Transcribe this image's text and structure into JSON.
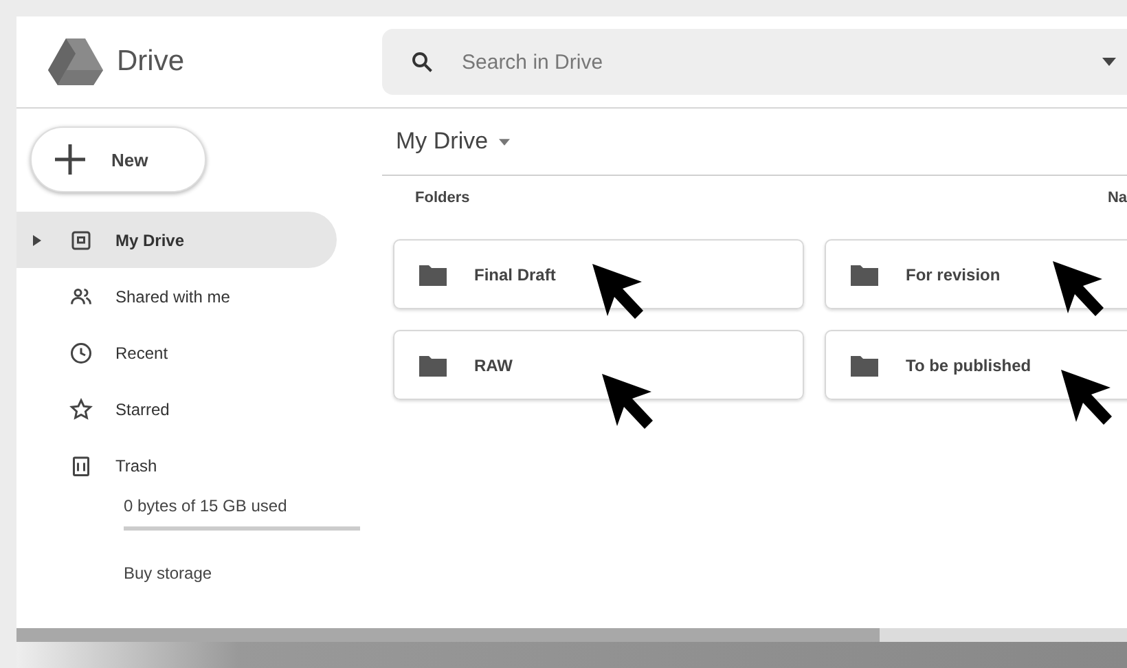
{
  "header": {
    "app_name": "Drive",
    "search": {
      "placeholder": "Search in Drive"
    }
  },
  "sidebar": {
    "new_button": "New",
    "items": [
      {
        "label": "My Drive",
        "kind": "drive",
        "selected": true,
        "expanded": false
      },
      {
        "label": "Shared with me",
        "kind": "people",
        "selected": false
      },
      {
        "label": "Recent",
        "kind": "clock",
        "selected": false
      },
      {
        "label": "Starred",
        "kind": "star",
        "selected": false
      },
      {
        "label": "Trash",
        "kind": "trash",
        "selected": false
      }
    ],
    "storage": {
      "text": "0 bytes of 15 GB used"
    },
    "buy_storage": "Buy storage"
  },
  "main": {
    "title": "My Drive",
    "section": "Folders",
    "column_2": "Na",
    "folders": [
      {
        "name": "Final Draft"
      },
      {
        "name": "For revision"
      },
      {
        "name": "RAW"
      },
      {
        "name": "To be published"
      }
    ]
  }
}
